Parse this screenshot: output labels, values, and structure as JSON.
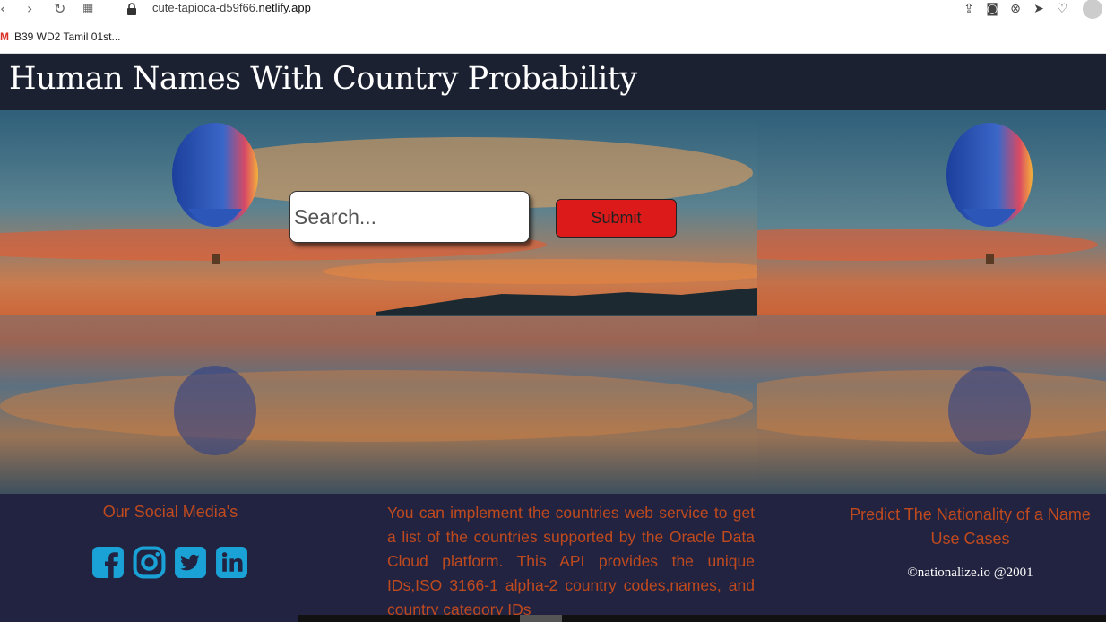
{
  "browser": {
    "url_prefix": "cute-tapioca-d59f66.",
    "url_domain": "netlify.app",
    "bookmark_label": "B39 WD2 Tamil 01st...",
    "bookmark_icon": "gmail-icon"
  },
  "header": {
    "title": "Human Names With Country Probability"
  },
  "search": {
    "placeholder": "Search...",
    "value": "",
    "submit_label": "Submit"
  },
  "footer": {
    "social_heading": "Our Social Media's",
    "social_icons": [
      "facebook-icon",
      "instagram-icon",
      "twitter-icon",
      "linkedin-icon"
    ],
    "description": "You can implement the countries web service to get a list of the countries supported by the Oracle Data Cloud platform. This API provides the unique IDs,ISO 3166-1 alpha-2 country codes,names, and country category IDs",
    "predict_heading_line1": "Predict The Nationality of a Name",
    "predict_heading_line2": "Use Cases",
    "copyright": "©nationalize.io @2001"
  },
  "colors": {
    "header_bg": "#1b2131",
    "footer_bg": "#222341",
    "accent_text": "#bf4a1e",
    "submit_bg": "#dd1a1a",
    "social_icon": "#1aa2d6"
  }
}
